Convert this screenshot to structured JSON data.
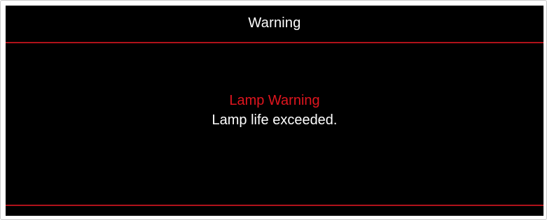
{
  "dialog": {
    "title": "Warning",
    "heading": "Lamp Warning",
    "message": "Lamp life exceeded."
  },
  "colors": {
    "background": "#000000",
    "text": "#ffffff",
    "accent": "#e0151e",
    "divider": "#b0121a"
  }
}
